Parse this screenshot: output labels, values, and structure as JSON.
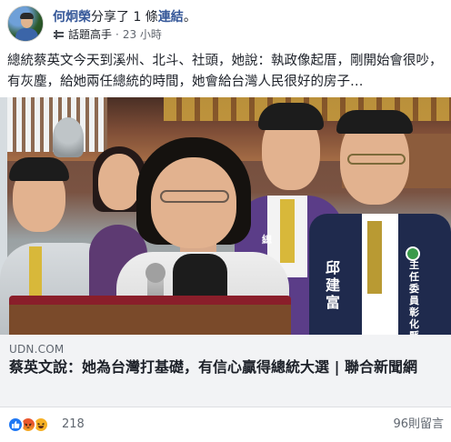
{
  "post": {
    "author": "何炯榮",
    "action": "分享了 1 條",
    "link_word": "連結",
    "action_end": "。",
    "badge": "話題高手",
    "separator": "·",
    "time": "23 小時",
    "text": "總統蔡英文今天到溪州、北斗、社頭，她說：執政像起厝，剛開始會很吵，有灰塵，給她兩任總統的時間，她會給台灣人民很好的房子…"
  },
  "photo": {
    "sash_text": "總",
    "vest_name": "邱建富",
    "vest_title": "主任委員",
    "vest_org": "彰化縣黨"
  },
  "link_card": {
    "domain": "UDN.COM",
    "title": "蔡英文說：她為台灣打基礎，有信心贏得總統大選 | 聯合新聞網"
  },
  "footer": {
    "reaction_count": "218",
    "comments": "96則留言",
    "reaction_icons": [
      "like-icon",
      "angry-icon",
      "haha-icon"
    ]
  },
  "colors": {
    "link_blue": "#365899",
    "like_blue": "#2078f4",
    "card_bg": "#f2f3f5",
    "muted_text": "#606770"
  }
}
